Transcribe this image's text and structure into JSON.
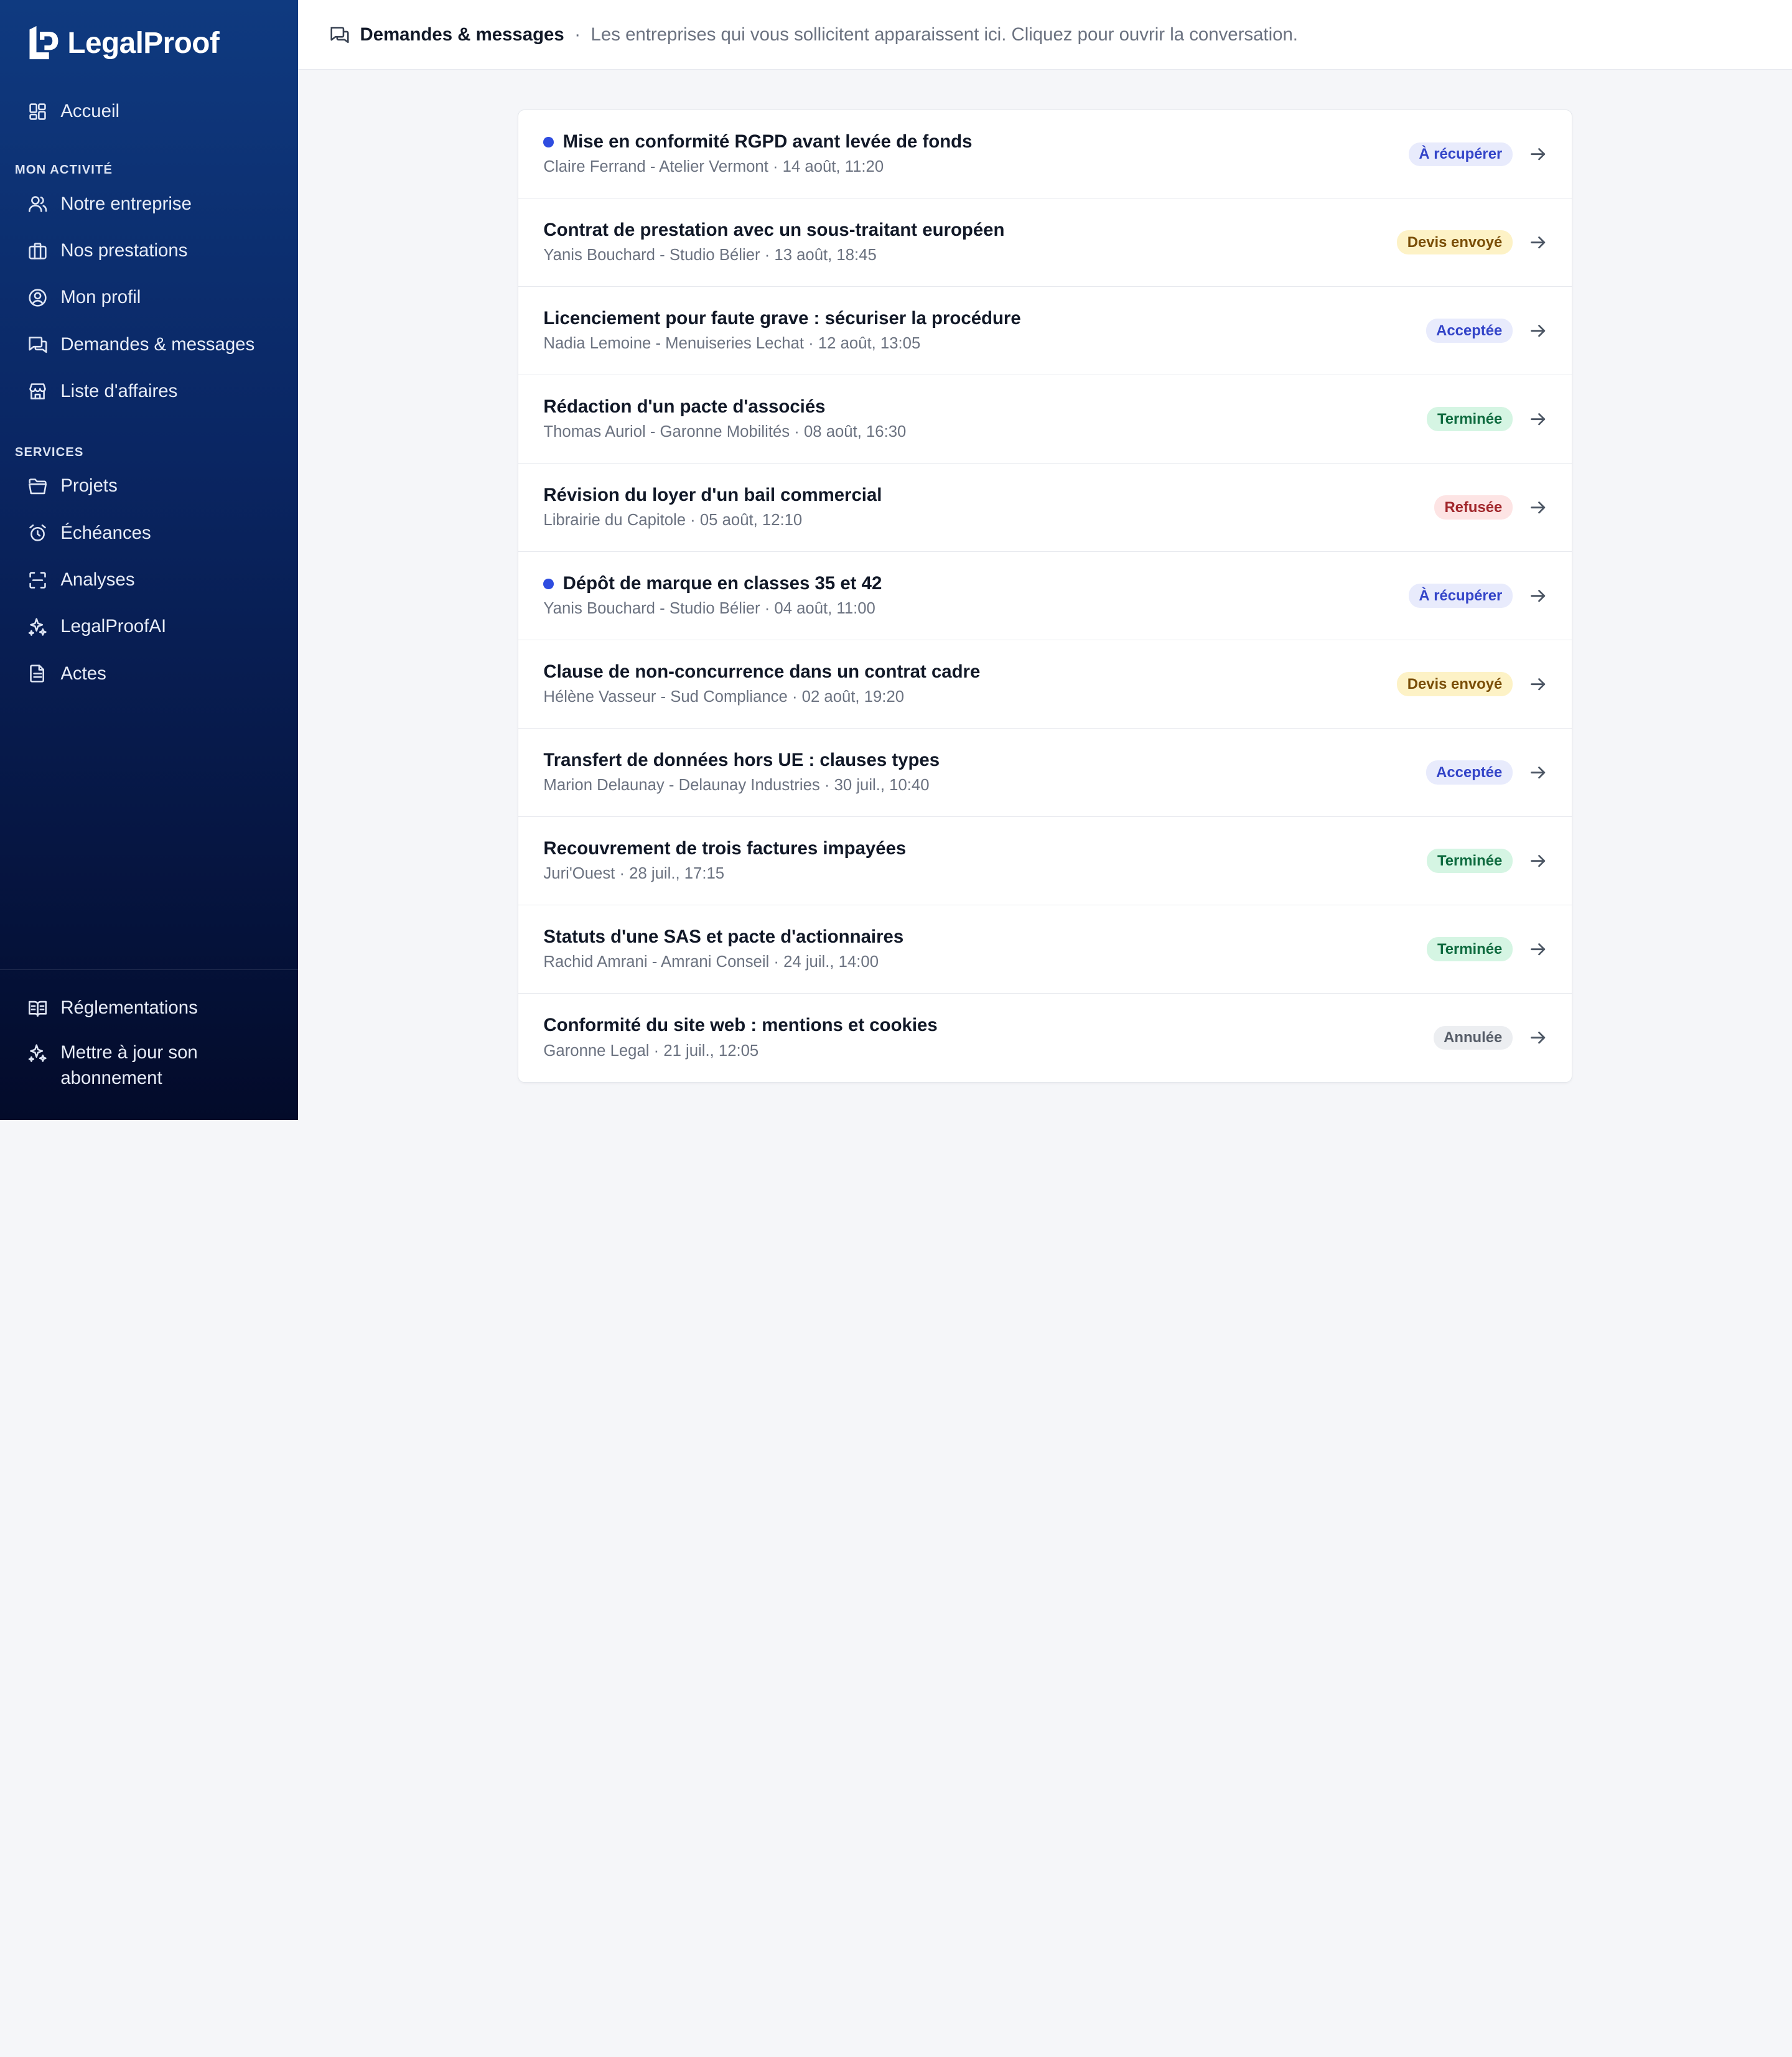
{
  "brand": {
    "name": "LegalProof",
    "logo_icon": "legalproof-logo-icon"
  },
  "sidebar": {
    "top_items": [
      {
        "label": "Accueil",
        "icon": "grid-icon"
      }
    ],
    "section_activity": "MON ACTIVITÉ",
    "activity_items": [
      {
        "label": "Notre entreprise",
        "icon": "users-icon"
      },
      {
        "label": "Nos prestations",
        "icon": "briefcase-icon"
      },
      {
        "label": "Mon profil",
        "icon": "user-circle-icon"
      },
      {
        "label": "Demandes & messages",
        "icon": "messages-icon"
      },
      {
        "label": "Liste d'affaires",
        "icon": "store-icon"
      }
    ],
    "section_services": "SERVICES",
    "services_items": [
      {
        "label": "Projets",
        "icon": "folder-icon"
      },
      {
        "label": "Échéances",
        "icon": "alarm-icon"
      },
      {
        "label": "Analyses",
        "icon": "scan-icon"
      },
      {
        "label": "LegalProofAI",
        "icon": "sparkles-icon"
      },
      {
        "label": "Actes",
        "icon": "document-icon"
      }
    ],
    "footer_items": [
      {
        "label": "Réglementations",
        "icon": "book-icon"
      },
      {
        "label": "Mettre à jour son abonnement",
        "icon": "sparkles-icon"
      }
    ]
  },
  "header": {
    "icon": "messages-icon",
    "title": "Demandes & messages",
    "separator": "·",
    "description": "Les entreprises qui vous sollicitent apparaissent ici. Cliquez pour ouvrir la conversation."
  },
  "requests": [
    {
      "title": "Mise en conformité RGPD avant levée de fonds",
      "meta": "Claire Ferrand - Atelier Vermont · 14 août, 11:20",
      "status": "À récupérer",
      "status_kind": "recup",
      "unread": true
    },
    {
      "title": "Contrat de prestation avec un sous-traitant européen",
      "meta": "Yanis Bouchard - Studio Bélier · 13 août, 18:45",
      "status": "Devis envoyé",
      "status_kind": "devis",
      "unread": false
    },
    {
      "title": "Licenciement pour faute grave : sécuriser la procédure",
      "meta": "Nadia Lemoine - Menuiseries Lechat · 12 août, 13:05",
      "status": "Acceptée",
      "status_kind": "acceptee",
      "unread": false
    },
    {
      "title": "Rédaction d'un pacte d'associés",
      "meta": "Thomas Auriol - Garonne Mobilités · 08 août, 16:30",
      "status": "Terminée",
      "status_kind": "terminee",
      "unread": false
    },
    {
      "title": "Révision du loyer d'un bail commercial",
      "meta": "Librairie du Capitole · 05 août, 12:10",
      "status": "Refusée",
      "status_kind": "refusee",
      "unread": false
    },
    {
      "title": "Dépôt de marque en classes 35 et 42",
      "meta": "Yanis Bouchard - Studio Bélier · 04 août, 11:00",
      "status": "À récupérer",
      "status_kind": "recup",
      "unread": true
    },
    {
      "title": "Clause de non-concurrence dans un contrat cadre",
      "meta": "Hélène Vasseur - Sud Compliance · 02 août, 19:20",
      "status": "Devis envoyé",
      "status_kind": "devis",
      "unread": false
    },
    {
      "title": "Transfert de données hors UE : clauses types",
      "meta": "Marion Delaunay - Delaunay Industries · 30 juil., 10:40",
      "status": "Acceptée",
      "status_kind": "acceptee",
      "unread": false
    },
    {
      "title": "Recouvrement de trois factures impayées",
      "meta": "Juri'Ouest · 28 juil., 17:15",
      "status": "Terminée",
      "status_kind": "terminee",
      "unread": false
    },
    {
      "title": "Statuts d'une SAS et pacte d'actionnaires",
      "meta": "Rachid Amrani - Amrani Conseil · 24 juil., 14:00",
      "status": "Terminée",
      "status_kind": "terminee",
      "unread": false
    },
    {
      "title": "Conformité du site web : mentions et cookies",
      "meta": "Garonne Legal · 21 juil., 12:05",
      "status": "Annulée",
      "status_kind": "annulee",
      "unread": false
    }
  ],
  "colors": {
    "sidebar_top": "#0f3a80",
    "sidebar_bottom": "#030b2a",
    "unread_dot": "#2f4de0",
    "page_bg": "#f5f6f9"
  }
}
